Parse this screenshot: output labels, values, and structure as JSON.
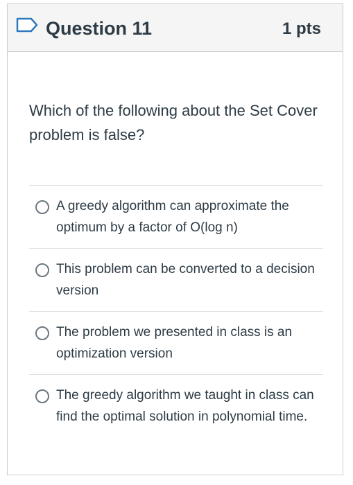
{
  "question": {
    "title": "Question 11",
    "points": "1 pts",
    "flag_icon": "bookmark-flag-icon",
    "text": "Which of the following about the Set Cover problem is false?"
  },
  "answers": [
    {
      "label": "A greedy algorithm can approximate the optimum by a factor of O(log n)",
      "selected": false
    },
    {
      "label": "This problem can be converted to a decision version",
      "selected": false
    },
    {
      "label": "The problem we presented in class is an optimization version",
      "selected": false
    },
    {
      "label": "The greedy algorithm we taught in class can find the optimal solution in polynomial time.",
      "selected": false
    }
  ],
  "colors": {
    "text": "#2d3b45",
    "header_bg": "#f5f5f5",
    "border": "#c7cdd1",
    "flag": "#2d7abf"
  }
}
